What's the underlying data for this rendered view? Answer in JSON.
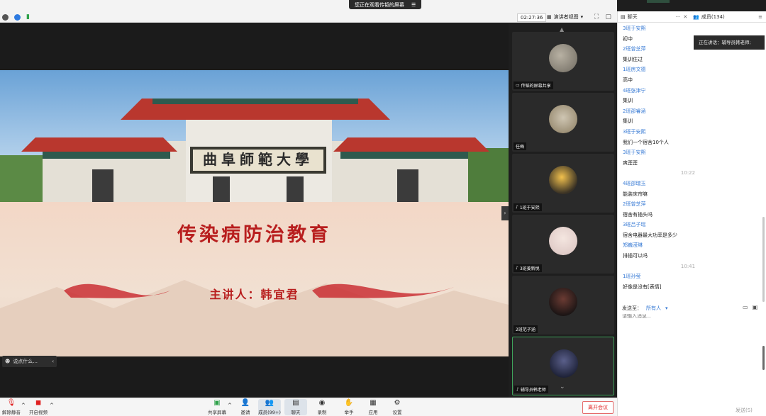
{
  "share_banner": {
    "text": "您正在观看传韬的屏幕"
  },
  "topbar": {
    "timer": "02:27:36",
    "view_label": "演讲者视图"
  },
  "slide": {
    "gate_text": "曲阜師範大學",
    "title": "传染病防治教育",
    "speaker": "主讲人：韩宜君"
  },
  "say_box": {
    "placeholder": "说点什么..."
  },
  "tiles": [
    {
      "name": "传韬的屏幕共享"
    },
    {
      "name": "任梅"
    },
    {
      "name": "1班于安熙"
    },
    {
      "name": "3班姜新悦"
    },
    {
      "name": "2班范子涵"
    },
    {
      "name": "辅导员韩老师"
    }
  ],
  "toolbar": {
    "mute": "解除静音",
    "video": "开启视频",
    "share": "共享屏幕",
    "invite": "邀请",
    "members": "成员(99+)",
    "chat": "聊天",
    "record": "录制",
    "raise": "举手",
    "apps": "应用",
    "settings": "设置",
    "leave": "离开会议"
  },
  "chat_panel": {
    "tab_chat": "聊天",
    "tab_members": "成员(134)",
    "messages": [
      {
        "kind": "sender",
        "text": "3班于安熙"
      },
      {
        "kind": "content",
        "text": "初中"
      },
      {
        "kind": "sender",
        "text": "2班曾芝萍"
      },
      {
        "kind": "content",
        "text": "集训住过"
      },
      {
        "kind": "sender",
        "text": "1班房文德"
      },
      {
        "kind": "content",
        "text": "高中"
      },
      {
        "kind": "sender",
        "text": "4班张津宁"
      },
      {
        "kind": "content",
        "text": "集训"
      },
      {
        "kind": "sender",
        "text": "2班邵睿涵"
      },
      {
        "kind": "content",
        "text": "集训"
      },
      {
        "kind": "sender",
        "text": "3班于安熙"
      },
      {
        "kind": "content",
        "text": "我们一个宿舍10个人"
      },
      {
        "kind": "sender",
        "text": "3班于安熙"
      },
      {
        "kind": "content",
        "text": "爽歪歪"
      },
      {
        "kind": "time",
        "text": "10:22"
      },
      {
        "kind": "sender",
        "text": "4班邵瑞玉"
      },
      {
        "kind": "content",
        "text": "能装床帘嘛"
      },
      {
        "kind": "sender",
        "text": "2班曾芝萍"
      },
      {
        "kind": "content",
        "text": "宿舍有插头吗"
      },
      {
        "kind": "sender",
        "text": "3班吕子瑶"
      },
      {
        "kind": "content",
        "text": "宿舍电器最大功率是多少"
      },
      {
        "kind": "sender",
        "text": "郑巍滢琳"
      },
      {
        "kind": "content",
        "text": "排插可以吗"
      },
      {
        "kind": "time",
        "text": "10:41"
      },
      {
        "kind": "sender",
        "text": "1班孙莹"
      },
      {
        "kind": "content",
        "text": "好像是没有[表情]"
      }
    ],
    "send_to_label": "发送至：",
    "send_to_target": "所有人",
    "input_placeholder": "请输入消息...",
    "send_button": "发送(S)",
    "speaking": "正在讲话：辅导员韩老师;"
  },
  "colors": {
    "accent": "#3478d4",
    "slide_red": "#b81e1e",
    "leave_red": "#e02020",
    "active_tile": "#3ea35a"
  }
}
